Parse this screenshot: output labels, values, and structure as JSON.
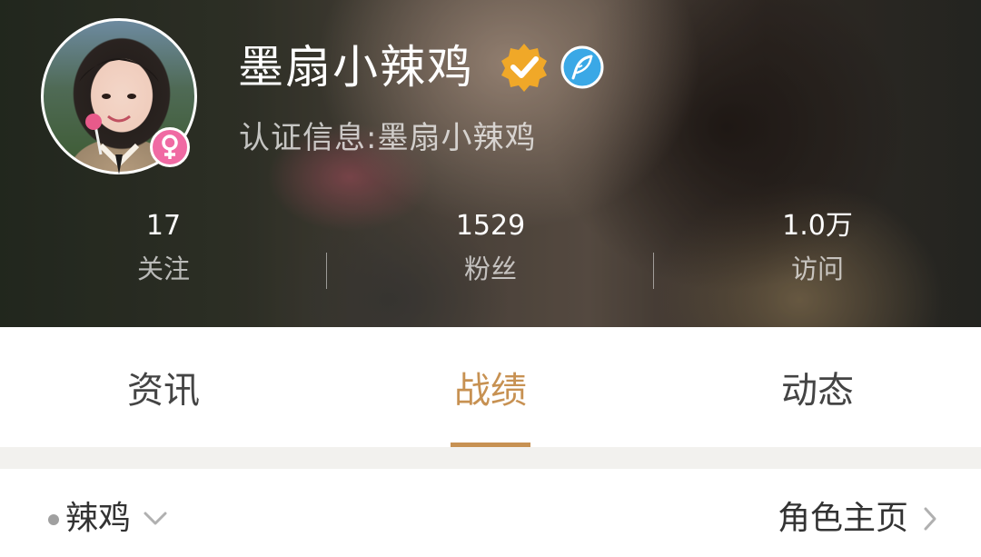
{
  "profile": {
    "username": "墨扇小辣鸡",
    "certification_label": "认证信息:",
    "certification_value": "墨扇小辣鸡",
    "gender": "female",
    "badges": [
      "verified-check-icon",
      "feather-icon"
    ]
  },
  "stats": {
    "follow": {
      "value": "17",
      "label": "关注"
    },
    "fans": {
      "value": "1529",
      "label": "粉丝"
    },
    "visits": {
      "value": "1.0万",
      "label": "访问"
    }
  },
  "tabs": [
    {
      "label": "资讯",
      "active": false
    },
    {
      "label": "战绩",
      "active": true
    },
    {
      "label": "动态",
      "active": false
    }
  ],
  "role_row": {
    "role_name": "辣鸡",
    "role_home_label": "角色主页"
  },
  "colors": {
    "accent": "#c79152",
    "gender_badge": "#f06aa3",
    "verify_badge": "#f0a828",
    "feather_badge": "#3aa8e6",
    "separator": "#f2f1ee"
  }
}
